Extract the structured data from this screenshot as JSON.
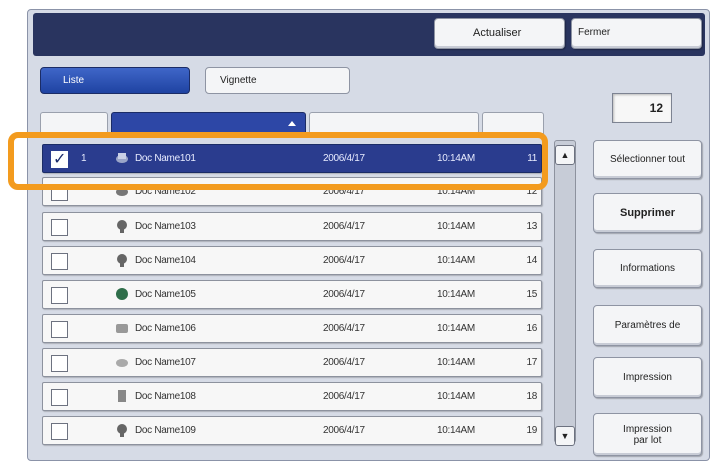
{
  "toolbar": {
    "refresh_label": "Actualiser",
    "close_label": "Fermer"
  },
  "view_tabs": {
    "list_label": "Liste",
    "thumbnail_label": "Vignette"
  },
  "document_count": "12",
  "rows": [
    {
      "num": "1",
      "name": "Doc Name101",
      "date": "2006/4/17",
      "time": "10:14AM",
      "count": "11",
      "selected": true,
      "checked": true
    },
    {
      "num": "",
      "name": "Doc Name102",
      "date": "2006/4/17",
      "time": "10:14AM",
      "count": "12",
      "selected": false,
      "checked": false
    },
    {
      "num": "",
      "name": "Doc Name103",
      "date": "2006/4/17",
      "time": "10:14AM",
      "count": "13",
      "selected": false,
      "checked": false
    },
    {
      "num": "",
      "name": "Doc Name104",
      "date": "2006/4/17",
      "time": "10:14AM",
      "count": "14",
      "selected": false,
      "checked": false
    },
    {
      "num": "",
      "name": "Doc Name105",
      "date": "2006/4/17",
      "time": "10:14AM",
      "count": "15",
      "selected": false,
      "checked": false
    },
    {
      "num": "",
      "name": "Doc Name106",
      "date": "2006/4/17",
      "time": "10:14AM",
      "count": "16",
      "selected": false,
      "checked": false
    },
    {
      "num": "",
      "name": "Doc Name107",
      "date": "2006/4/17",
      "time": "10:14AM",
      "count": "17",
      "selected": false,
      "checked": false
    },
    {
      "num": "",
      "name": "Doc Name108",
      "date": "2006/4/17",
      "time": "10:14AM",
      "count": "18",
      "selected": false,
      "checked": false
    },
    {
      "num": "",
      "name": "Doc Name109",
      "date": "2006/4/17",
      "time": "10:14AM",
      "count": "19",
      "selected": false,
      "checked": false
    }
  ],
  "side_buttons": {
    "select_all": "Sélectionner tout",
    "delete": "Supprimer",
    "info": "Informations",
    "params": "Paramètres de",
    "print": "Impression",
    "batch_print_1": "Impression",
    "batch_print_2": "par lot"
  },
  "colors": {
    "highlight": "#f39b1e",
    "header": "#29345f",
    "selected_row": "#2a3c8e"
  }
}
